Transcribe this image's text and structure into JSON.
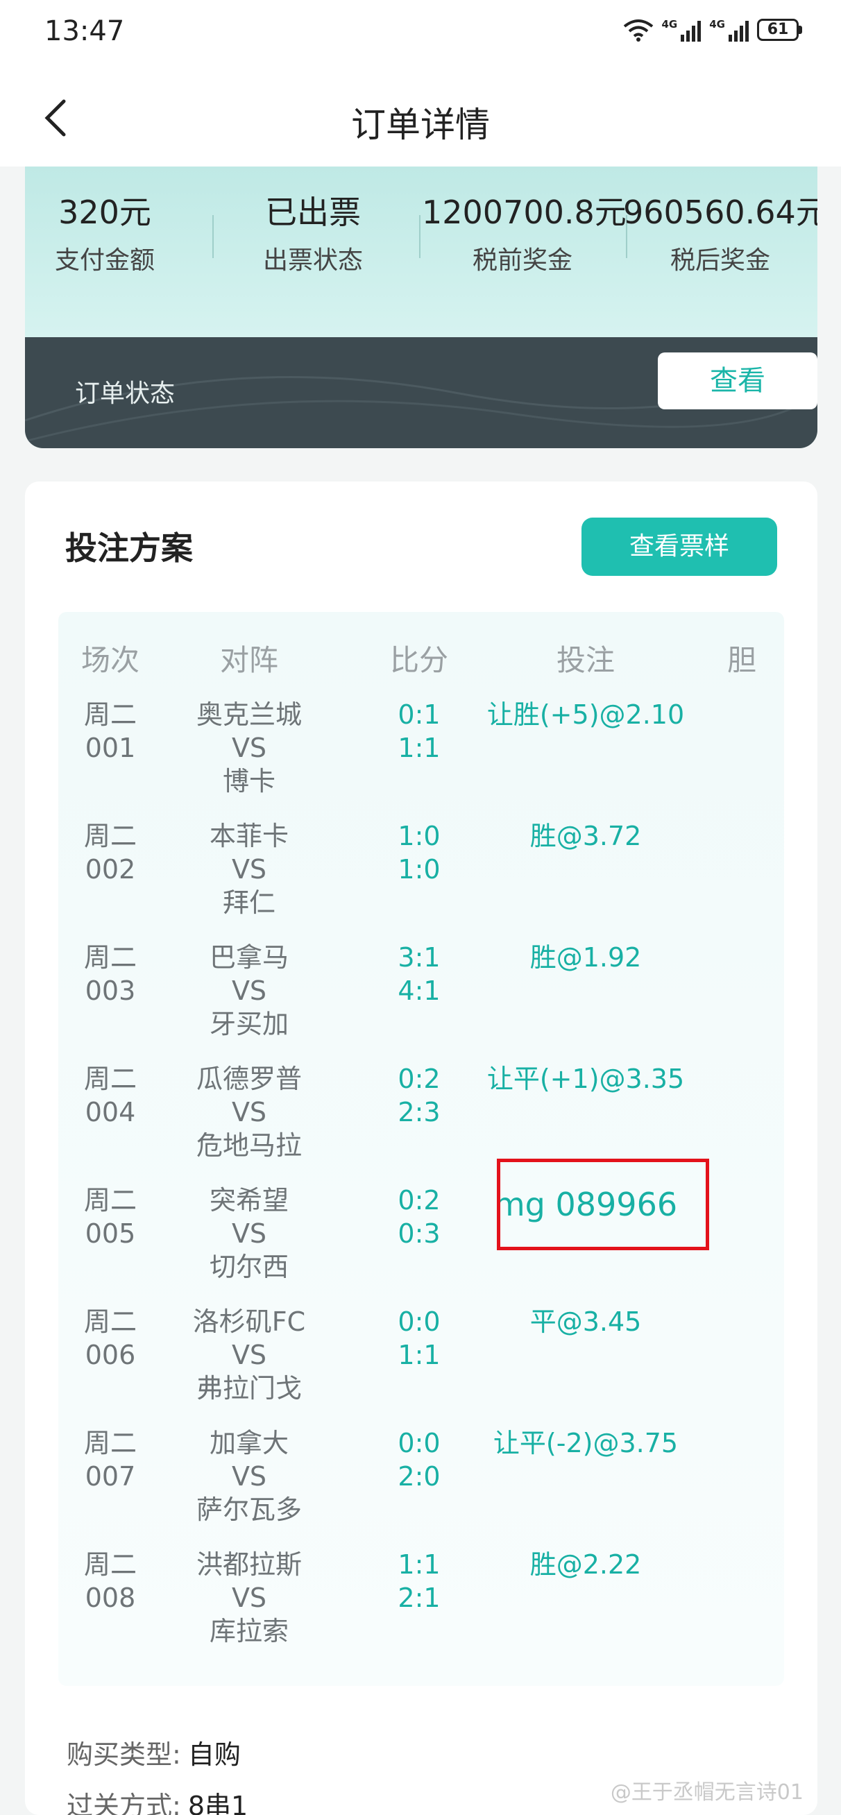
{
  "status_bar": {
    "time": "13:47",
    "signal1_label": "4G",
    "signal2_label": "4G",
    "battery": "61",
    "icons": [
      "wifi-icon",
      "signal-icon",
      "signal-icon",
      "battery-icon"
    ]
  },
  "nav": {
    "title": "订单详情",
    "back_icon": "chevron-left-icon"
  },
  "summary": {
    "stats": [
      {
        "value": "320元",
        "label": "支付金额"
      },
      {
        "value": "已出票",
        "label": "出票状态"
      },
      {
        "value": "1200700.8元",
        "label": "税前奖金"
      },
      {
        "value": "960560.64元",
        "label": "税后奖金"
      }
    ],
    "order_status_label": "订单状态",
    "view_button": "查看"
  },
  "plan": {
    "title": "投注方案",
    "ticket_button": "查看票样",
    "headers": {
      "round": "场次",
      "match": "对阵",
      "score": "比分",
      "bet": "投注",
      "banker": "胆"
    },
    "rows": [
      {
        "day": "周二",
        "no": "001",
        "home": "奥克兰城",
        "vs": "VS",
        "away": "博卡",
        "score1": "0:1",
        "score2": "1:1",
        "bet": "让胜(+5)@2.10"
      },
      {
        "day": "周二",
        "no": "002",
        "home": "本菲卡",
        "vs": "VS",
        "away": "拜仁",
        "score1": "1:0",
        "score2": "1:0",
        "bet": "胜@3.72"
      },
      {
        "day": "周二",
        "no": "003",
        "home": "巴拿马",
        "vs": "VS",
        "away": "牙买加",
        "score1": "3:1",
        "score2": "4:1",
        "bet": "胜@1.92"
      },
      {
        "day": "周二",
        "no": "004",
        "home": "瓜德罗普",
        "vs": "VS",
        "away": "危地马拉",
        "score1": "0:2",
        "score2": "2:3",
        "bet": "让平(+1)@3.35"
      },
      {
        "day": "周二",
        "no": "005",
        "home": "突希望",
        "vs": "VS",
        "away": "切尔西",
        "score1": "0:2",
        "score2": "0:3",
        "bet": "mg 089966"
      },
      {
        "day": "周二",
        "no": "006",
        "home": "洛杉矶FC",
        "vs": "VS",
        "away": "弗拉门戈",
        "score1": "0:0",
        "score2": "1:1",
        "bet": "平@3.45"
      },
      {
        "day": "周二",
        "no": "007",
        "home": "加拿大",
        "vs": "VS",
        "away": "萨尔瓦多",
        "score1": "0:0",
        "score2": "2:0",
        "bet": "让平(-2)@3.75"
      },
      {
        "day": "周二",
        "no": "008",
        "home": "洪都拉斯",
        "vs": "VS",
        "away": "库拉索",
        "score1": "1:1",
        "score2": "2:1",
        "bet": "胜@2.22"
      }
    ],
    "purchase_type_label": "购买类型:",
    "purchase_type_value": "自购",
    "pass_type_label": "过关方式:",
    "pass_type_value": "8串1"
  },
  "watermark": "@王于丞帽无言诗01",
  "colors": {
    "accent": "#1fbfb0",
    "highlight": "#e3121b",
    "dark_band": "#3d4a50"
  }
}
